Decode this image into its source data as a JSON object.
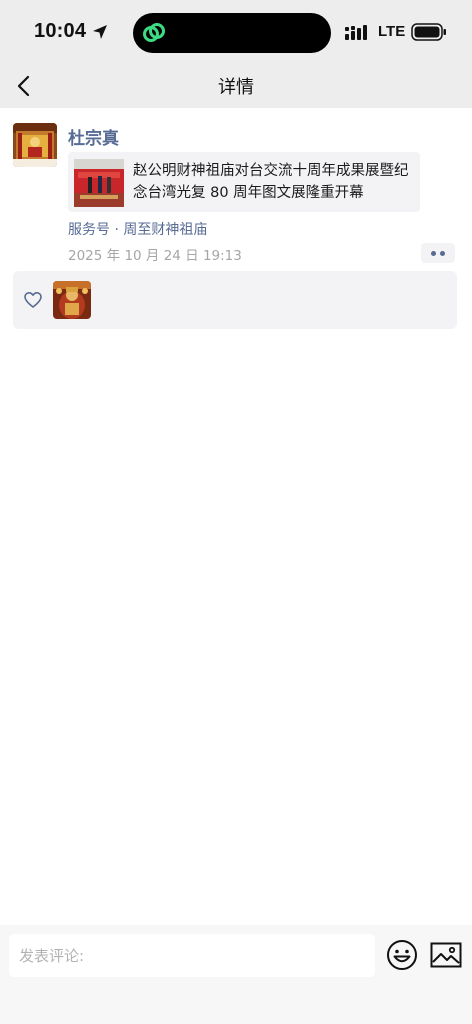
{
  "status_bar": {
    "time": "10:04",
    "network": "LTE",
    "icons": [
      "location-arrow-icon",
      "link-rings-icon",
      "signal-icon",
      "battery-icon"
    ]
  },
  "nav": {
    "title": "详情",
    "back_icon": "chevron-left-icon"
  },
  "post": {
    "author": "杜宗真",
    "shared_article": {
      "title": "赵公明财神祖庙对台交流十周年成果展暨纪念台湾光复 80 周年图文展隆重开幕"
    },
    "source": "服务号 · 周至财神祖庙",
    "timestamp": "2025 年 10 月 24 日 19:13",
    "more_icon": "more-dots-icon"
  },
  "likes": {
    "icon": "heart-outline-icon"
  },
  "comment_bar": {
    "placeholder": "发表评论:",
    "emoji_icon": "smiley-icon",
    "image_icon": "image-icon"
  },
  "colors": {
    "link_blue": "#576b95",
    "bar_gray": "#ededed",
    "card_gray": "#f3f3f5",
    "meta_gray": "#a6a6a6"
  }
}
